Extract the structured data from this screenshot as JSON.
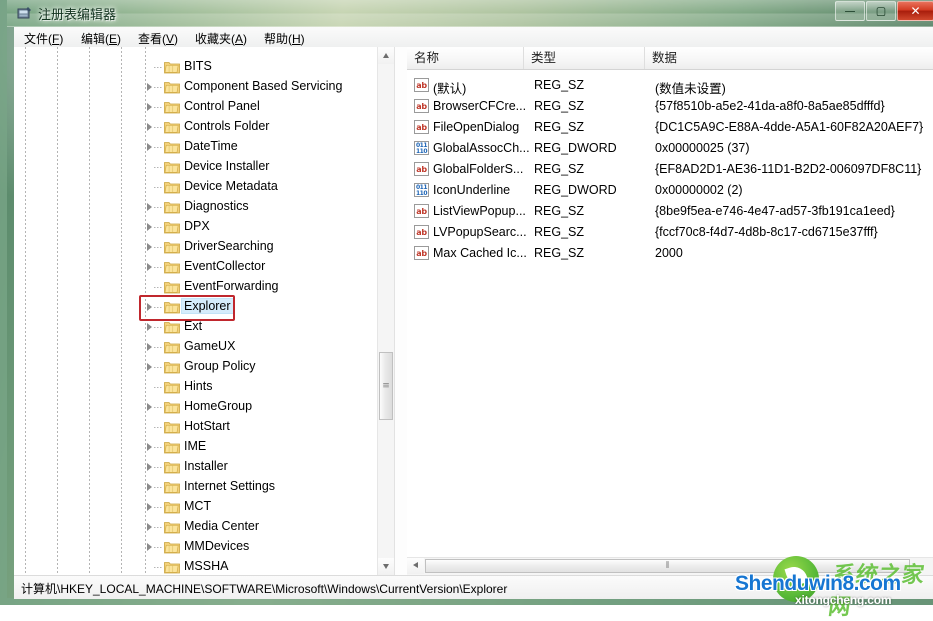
{
  "window": {
    "title": "注册表编辑器",
    "icon": "registry-editor-icon",
    "controls": {
      "minimize_label": "—",
      "maximize_label": "▢",
      "close_label": "✕"
    }
  },
  "menu": {
    "items": [
      {
        "label": "文件(F)",
        "mnemonic": "F",
        "text": "文件(",
        "tail": ")"
      },
      {
        "label": "编辑(E)",
        "mnemonic": "E",
        "text": "编辑(",
        "tail": ")"
      },
      {
        "label": "查看(V)",
        "mnemonic": "V",
        "text": "查看(",
        "tail": ")"
      },
      {
        "label": "收藏夹(A)",
        "mnemonic": "A",
        "text": "收藏夹(",
        "tail": ")"
      },
      {
        "label": "帮助(H)",
        "mnemonic": "H",
        "text": "帮助(",
        "tail": ")"
      }
    ]
  },
  "tree": {
    "items": [
      {
        "label": "BITS",
        "expandable": false,
        "selected": false
      },
      {
        "label": "Component Based Servicing",
        "expandable": true,
        "selected": false
      },
      {
        "label": "Control Panel",
        "expandable": true,
        "selected": false
      },
      {
        "label": "Controls Folder",
        "expandable": true,
        "selected": false
      },
      {
        "label": "DateTime",
        "expandable": true,
        "selected": false
      },
      {
        "label": "Device Installer",
        "expandable": false,
        "selected": false
      },
      {
        "label": "Device Metadata",
        "expandable": false,
        "selected": false
      },
      {
        "label": "Diagnostics",
        "expandable": true,
        "selected": false
      },
      {
        "label": "DPX",
        "expandable": true,
        "selected": false
      },
      {
        "label": "DriverSearching",
        "expandable": true,
        "selected": false
      },
      {
        "label": "EventCollector",
        "expandable": true,
        "selected": false
      },
      {
        "label": "EventForwarding",
        "expandable": false,
        "selected": false
      },
      {
        "label": "Explorer",
        "expandable": true,
        "selected": true
      },
      {
        "label": "Ext",
        "expandable": true,
        "selected": false
      },
      {
        "label": "GameUX",
        "expandable": true,
        "selected": false
      },
      {
        "label": "Group Policy",
        "expandable": true,
        "selected": false
      },
      {
        "label": "Hints",
        "expandable": false,
        "selected": false
      },
      {
        "label": "HomeGroup",
        "expandable": true,
        "selected": false
      },
      {
        "label": "HotStart",
        "expandable": false,
        "selected": false
      },
      {
        "label": "IME",
        "expandable": true,
        "selected": false
      },
      {
        "label": "Installer",
        "expandable": true,
        "selected": false
      },
      {
        "label": "Internet Settings",
        "expandable": true,
        "selected": false
      },
      {
        "label": "MCT",
        "expandable": true,
        "selected": false
      },
      {
        "label": "Media Center",
        "expandable": true,
        "selected": false
      },
      {
        "label": "MMDevices",
        "expandable": true,
        "selected": false
      },
      {
        "label": "MSSHA",
        "expandable": false,
        "selected": false
      }
    ],
    "highlight_color": "#c0272d",
    "selection_color": "#d5ecfb"
  },
  "list": {
    "columns": [
      {
        "label": "名称",
        "key": "name"
      },
      {
        "label": "类型",
        "key": "type"
      },
      {
        "label": "数据",
        "key": "data"
      }
    ],
    "rows": [
      {
        "name": "(默认)",
        "type": "REG_SZ",
        "data": "(数值未设置)",
        "icon": "string-value-icon"
      },
      {
        "name": "BrowserCFCre...",
        "type": "REG_SZ",
        "data": "{57f8510b-a5e2-41da-a8f0-8a5ae85dfffd}",
        "icon": "string-value-icon"
      },
      {
        "name": "FileOpenDialog",
        "type": "REG_SZ",
        "data": "{DC1C5A9C-E88A-4dde-A5A1-60F82A20AEF7}",
        "icon": "string-value-icon"
      },
      {
        "name": "GlobalAssocCh...",
        "type": "REG_DWORD",
        "data": "0x00000025 (37)",
        "icon": "dword-value-icon"
      },
      {
        "name": "GlobalFolderS...",
        "type": "REG_SZ",
        "data": "{EF8AD2D1-AE36-11D1-B2D2-006097DF8C11}",
        "icon": "string-value-icon"
      },
      {
        "name": "IconUnderline",
        "type": "REG_DWORD",
        "data": "0x00000002 (2)",
        "icon": "dword-value-icon"
      },
      {
        "name": "ListViewPopup...",
        "type": "REG_SZ",
        "data": "{8be9f5ea-e746-4e47-ad57-3fb191ca1eed}",
        "icon": "string-value-icon"
      },
      {
        "name": "LVPopupSearc...",
        "type": "REG_SZ",
        "data": "{fccf70c8-f4d7-4d8b-8c17-cd6715e37fff}",
        "icon": "string-value-icon"
      },
      {
        "name": "Max Cached Ic...",
        "type": "REG_SZ",
        "data": "2000",
        "icon": "string-value-icon"
      }
    ]
  },
  "statusbar": {
    "path": "计算机\\HKEY_LOCAL_MACHINE\\SOFTWARE\\Microsoft\\Windows\\CurrentVersion\\Explorer"
  },
  "watermark": {
    "main": "Shenduwin8.com",
    "sub": "xitongcheng.com",
    "cn": "系统之家网"
  },
  "icons": {
    "string_value": "ab",
    "dword_top": "011",
    "dword_bottom": "110"
  }
}
